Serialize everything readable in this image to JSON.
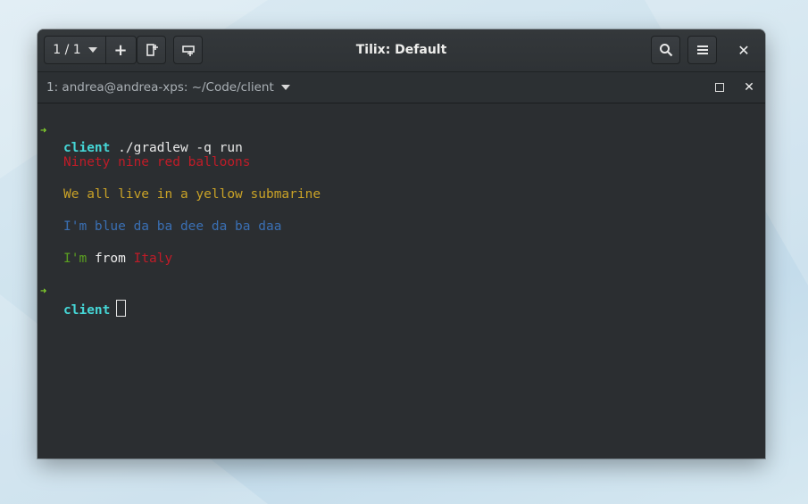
{
  "window": {
    "title": "Tilix: Default",
    "session_counter": "1 / 1"
  },
  "icons": {
    "add": "+",
    "close": "✕",
    "dropdown": "chevron-down-icon",
    "search": "search-icon",
    "menu": "hamburger-menu-icon",
    "add_terminal_right": "add-terminal-right-icon",
    "add_terminal_down": "add-terminal-down-icon",
    "maximize": "maximize-icon"
  },
  "terminal": {
    "title": "1: andrea@andrea-xps: ~/Code/client",
    "prompt_dir": "client",
    "command": "./gradlew -q run",
    "output": {
      "line1": "Ninety nine red balloons",
      "line2": "We all live in a yellow submarine",
      "line3": "I'm blue da ba dee da ba daa",
      "line4_a": "I'm",
      "line4_b": "from",
      "line4_c": "Italy"
    },
    "arrow": "➜"
  },
  "colors": {
    "prompt_arrow": "#84d32b",
    "prompt_dir": "#45d6d6",
    "red": "#c01c28",
    "yellow": "#c9a227",
    "blue": "#3a6fb3",
    "green": "#5ba021"
  }
}
